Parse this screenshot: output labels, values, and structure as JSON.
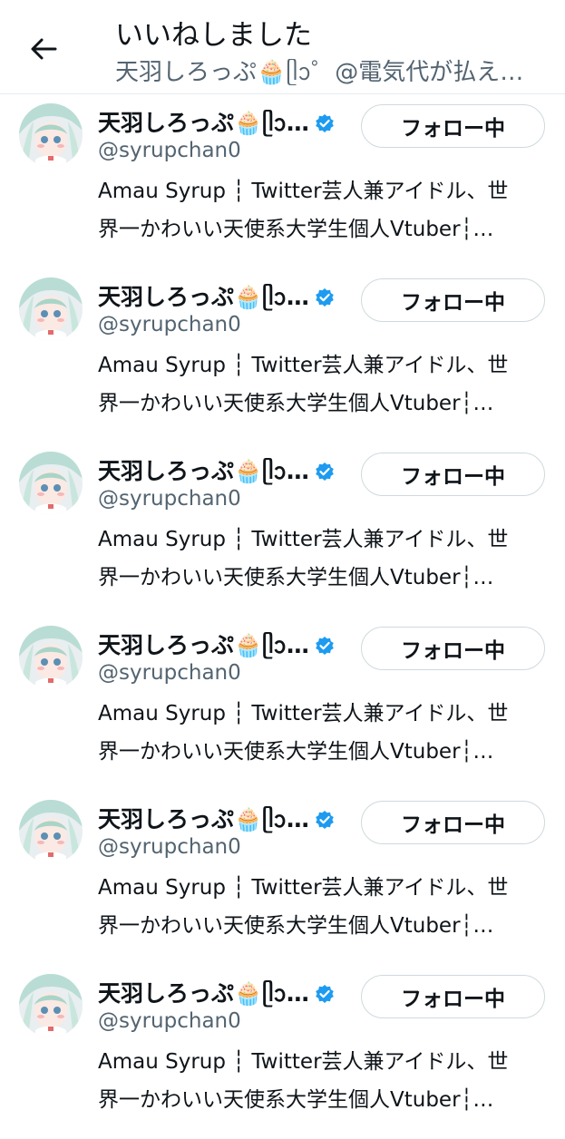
{
  "header": {
    "title": "いいねしました",
    "subtitle": "天羽しろっぷ🧁ᥫᩣ゜@電気代が払え…",
    "back_icon": "arrow-left-icon"
  },
  "users": [
    {
      "name": "天羽しろっぷ🧁ᥫᩣ…",
      "handle": "@syrupchan0",
      "follow_label": "フォロー中",
      "bio_line1": "Amau Syrup ┆ Twitter芸人兼アイドル、世",
      "bio_line2": "界一かわいい天使系大学生個人Vtuber┆…",
      "verified": true
    },
    {
      "name": "天羽しろっぷ🧁ᥫᩣ…",
      "handle": "@syrupchan0",
      "follow_label": "フォロー中",
      "bio_line1": "Amau Syrup ┆ Twitter芸人兼アイドル、世",
      "bio_line2": "界一かわいい天使系大学生個人Vtuber┆…",
      "verified": true
    },
    {
      "name": "天羽しろっぷ🧁ᥫᩣ…",
      "handle": "@syrupchan0",
      "follow_label": "フォロー中",
      "bio_line1": "Amau Syrup ┆ Twitter芸人兼アイドル、世",
      "bio_line2": "界一かわいい天使系大学生個人Vtuber┆…",
      "verified": true
    },
    {
      "name": "天羽しろっぷ🧁ᥫᩣ…",
      "handle": "@syrupchan0",
      "follow_label": "フォロー中",
      "bio_line1": "Amau Syrup ┆ Twitter芸人兼アイドル、世",
      "bio_line2": "界一かわいい天使系大学生個人Vtuber┆…",
      "verified": true
    },
    {
      "name": "天羽しろっぷ🧁ᥫᩣ…",
      "handle": "@syrupchan0",
      "follow_label": "フォロー中",
      "bio_line1": "Amau Syrup ┆ Twitter芸人兼アイドル、世",
      "bio_line2": "界一かわいい天使系大学生個人Vtuber┆…",
      "verified": true
    },
    {
      "name": "天羽しろっぷ🧁ᥫᩣ…",
      "handle": "@syrupchan0",
      "follow_label": "フォロー中",
      "bio_line1": "Amau Syrup ┆ Twitter芸人兼アイドル、世",
      "bio_line2": "界一かわいい天使系大学生個人Vtuber┆…",
      "verified": true
    }
  ],
  "colors": {
    "text_primary": "#0f1419",
    "text_secondary": "#536471",
    "verified_blue": "#1d9bf0",
    "border": "#cfd9de"
  }
}
